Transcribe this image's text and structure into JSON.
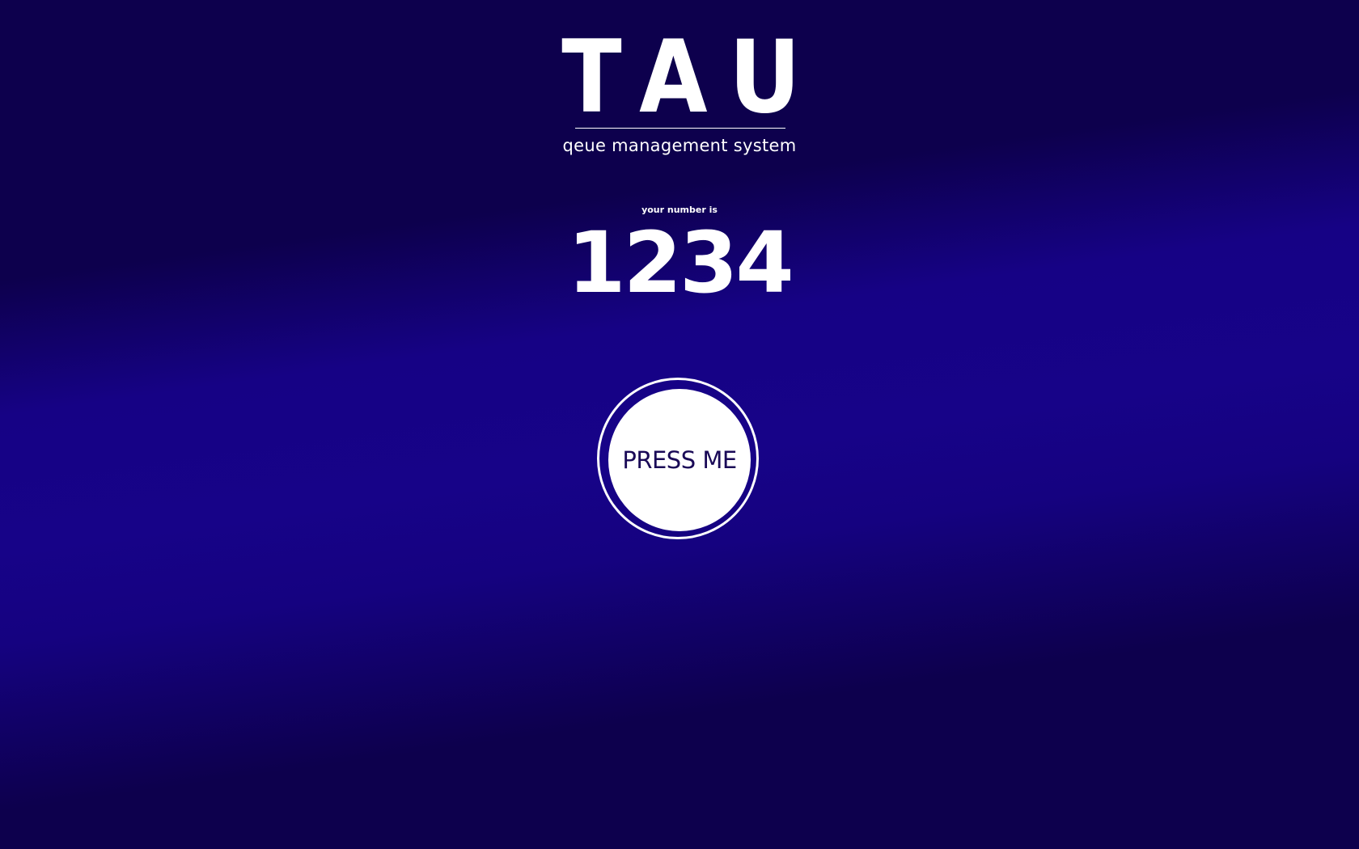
{
  "brand": {
    "title": "TAU",
    "subtitle": "qeue management system"
  },
  "ticket": {
    "caption": "your number is",
    "number": "1234"
  },
  "action": {
    "button_label": "PRESS ME"
  },
  "colors": {
    "background": "#0d004d",
    "glow": "#170388",
    "foreground": "#ffffff",
    "button_text": "#1a0a57"
  }
}
